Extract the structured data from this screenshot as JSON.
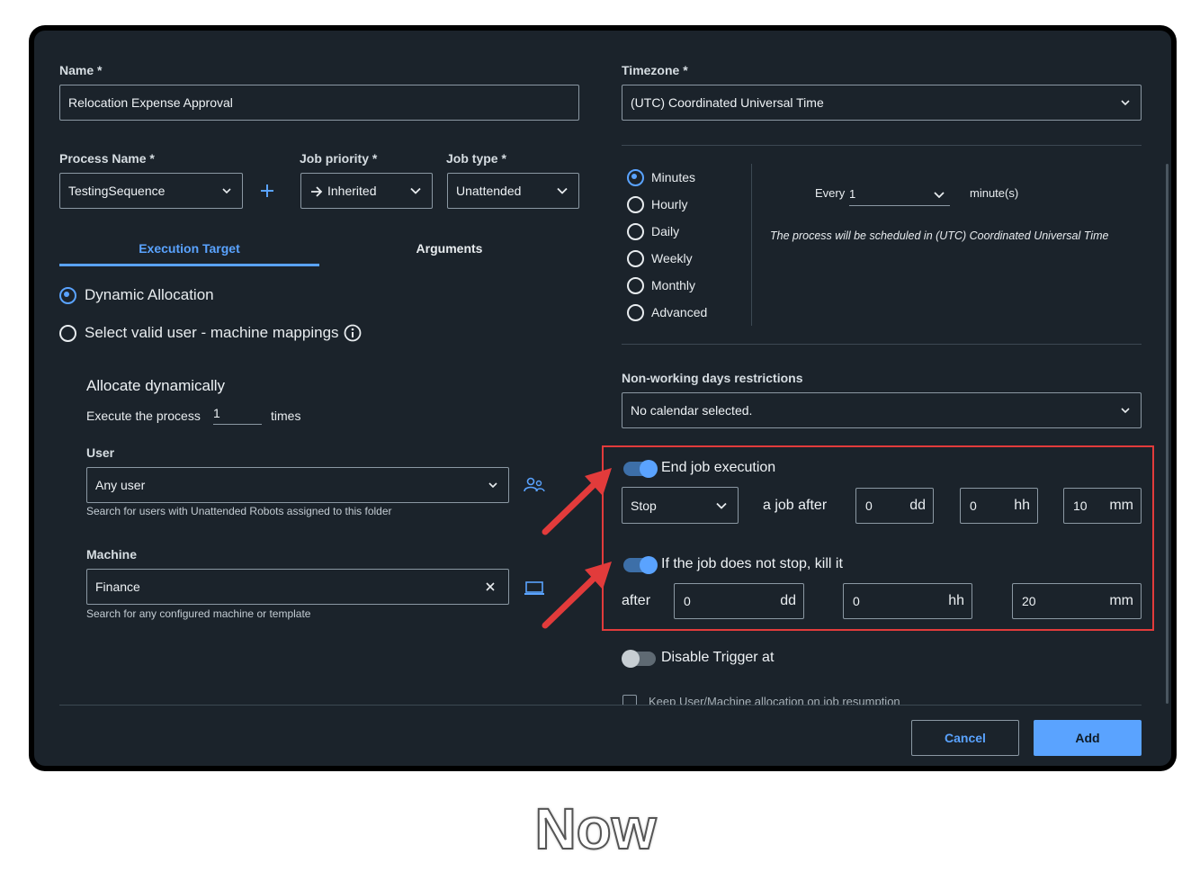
{
  "form": {
    "name": {
      "label": "Name *",
      "value": "Relocation Expense Approval"
    },
    "process_name": {
      "label": "Process Name *",
      "value": "TestingSequence"
    },
    "job_priority": {
      "label": "Job priority *",
      "value": "Inherited",
      "icon": "arrow-right-icon"
    },
    "job_type": {
      "label": "Job type *",
      "value": "Unattended"
    },
    "timezone": {
      "label": "Timezone *",
      "value": "(UTC) Coordinated Universal Time"
    }
  },
  "tabs": [
    {
      "label": "Execution Target",
      "active": true
    },
    {
      "label": "Arguments",
      "active": false
    }
  ],
  "allocation": {
    "options": [
      {
        "label": "Dynamic Allocation",
        "selected": true
      },
      {
        "label": "Select valid user - machine mappings",
        "selected": false
      }
    ],
    "heading": "Allocate dynamically",
    "execute_prefix": "Execute the process",
    "execute_count": "1",
    "execute_suffix": "times"
  },
  "user": {
    "label": "User",
    "value": "Any user",
    "hint": "Search for users with Unattended Robots assigned to this folder"
  },
  "machine": {
    "label": "Machine",
    "value": "Finance",
    "hint": "Search for any configured machine or template"
  },
  "schedule": {
    "frequencies": [
      {
        "label": "Minutes",
        "selected": true
      },
      {
        "label": "Hourly",
        "selected": false
      },
      {
        "label": "Daily",
        "selected": false
      },
      {
        "label": "Weekly",
        "selected": false
      },
      {
        "label": "Monthly",
        "selected": false
      },
      {
        "label": "Advanced",
        "selected": false
      }
    ],
    "every_label": "Every",
    "every_value": "1",
    "every_unit": "minute(s)",
    "note": "The process will be scheduled in (UTC) Coordinated Universal Time"
  },
  "non_working": {
    "label": "Non-working days restrictions",
    "value": "No calendar selected."
  },
  "end_job": {
    "label": "End job execution",
    "enabled": true,
    "action": "Stop",
    "after_text": "a job after",
    "dd": "0",
    "hh": "0",
    "mm": "10",
    "units": {
      "dd": "dd",
      "hh": "hh",
      "mm": "mm"
    }
  },
  "kill_job": {
    "label": "If the job does not stop, kill it",
    "enabled": true,
    "after_text": "after",
    "dd": "0",
    "hh": "0",
    "mm": "20"
  },
  "disable_trigger": {
    "label": "Disable Trigger at",
    "enabled": false
  },
  "keep_allocation": {
    "label": "Keep User/Machine allocation on job resumption"
  },
  "buttons": {
    "cancel": "Cancel",
    "add": "Add"
  },
  "caption": "Now",
  "colors": {
    "accent": "#5aa3ff",
    "highlight": "#e23b3b",
    "background": "#1b232b"
  }
}
